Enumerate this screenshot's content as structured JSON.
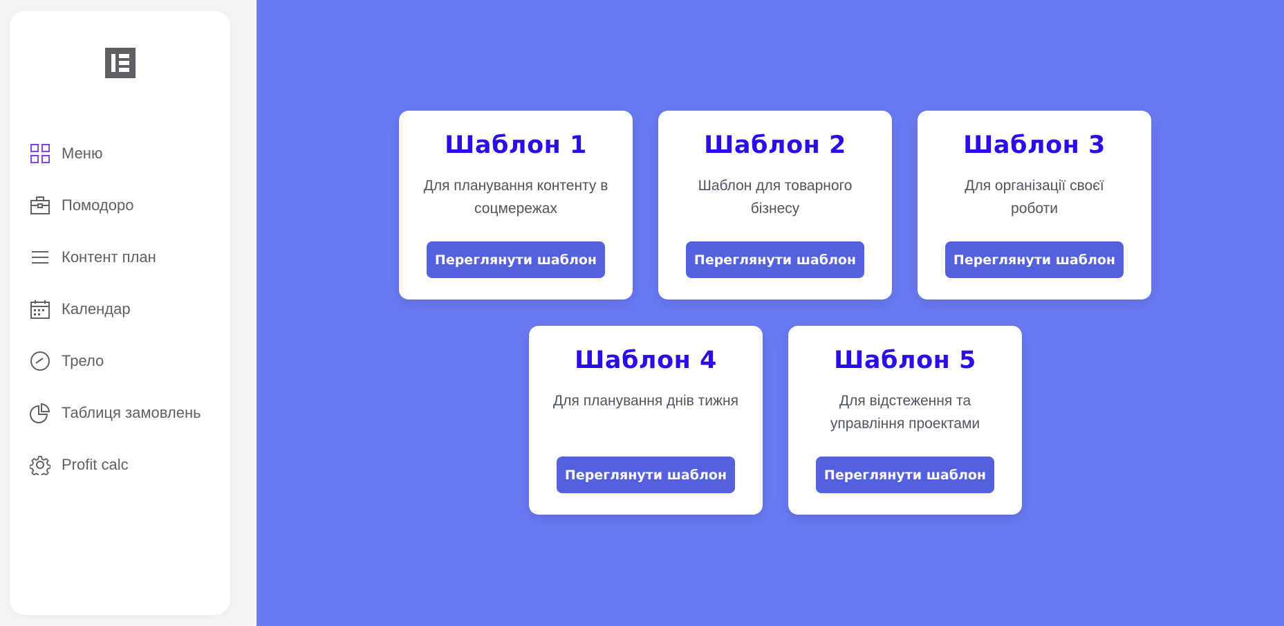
{
  "sidebar": {
    "logo_icon": "elementor-logo-icon",
    "items": [
      {
        "label": "Меню",
        "icon": "grid-icon"
      },
      {
        "label": "Помодоро",
        "icon": "briefcase-icon"
      },
      {
        "label": "Контент план",
        "icon": "menu-lines-icon"
      },
      {
        "label": "Календар",
        "icon": "calendar-icon"
      },
      {
        "label": "Трело",
        "icon": "gauge-icon"
      },
      {
        "label": "Таблиця замовлень",
        "icon": "pie-chart-icon"
      },
      {
        "label": "Profit calc",
        "icon": "gear-icon"
      }
    ]
  },
  "templates": [
    {
      "title": "Шаблон 1",
      "description": "Для планування контенту в соцмережах",
      "button": "Переглянути шаблон"
    },
    {
      "title": "Шаблон 2",
      "description": "Шаблон для товарного бізнесу",
      "button": "Переглянути шаблон"
    },
    {
      "title": "Шаблон 3",
      "description": "Для організації своєї роботи",
      "button": "Переглянути шаблон"
    },
    {
      "title": "Шаблон 4",
      "description": "Для планування днів тижня",
      "button": "Переглянути шаблон"
    },
    {
      "title": "Шаблон 5",
      "description": "Для відстеження та управління проектами",
      "button": "Переглянути шаблон"
    }
  ],
  "colors": {
    "main_background": "#6b7af2",
    "card_title": "#2a0ee6",
    "button": "#5560de",
    "active_icon": "#7b3fe4"
  }
}
